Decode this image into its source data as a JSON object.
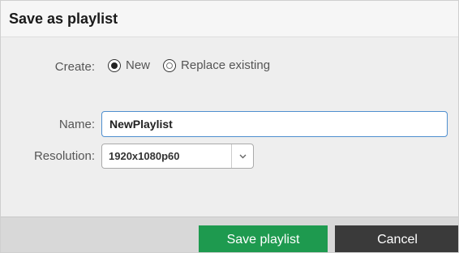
{
  "dialog": {
    "title": "Save as playlist"
  },
  "create": {
    "label": "Create:",
    "options": [
      {
        "label": "New",
        "selected": true
      },
      {
        "label": "Replace existing",
        "selected": false
      }
    ]
  },
  "name": {
    "label": "Name:",
    "value": "NewPlaylist"
  },
  "resolution": {
    "label": "Resolution:",
    "value": "1920x1080p60"
  },
  "buttons": {
    "save_label": "Save playlist",
    "cancel_label": "Cancel"
  },
  "colors": {
    "save_button": "#1e9a4f",
    "cancel_button": "#3a3a3a",
    "input_focus_border": "#4f8fcf"
  }
}
